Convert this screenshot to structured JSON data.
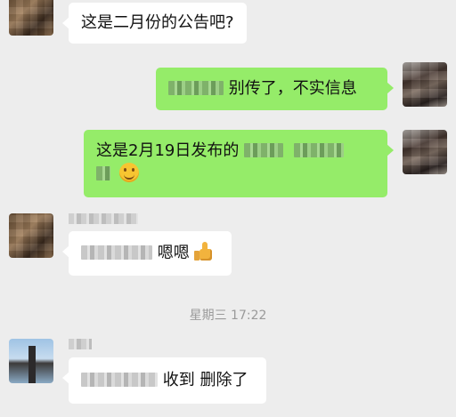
{
  "messages": [
    {
      "id": "m1",
      "side": "left",
      "avatar_icon": "brown-portrait-avatar",
      "text": "这是二月份的公告吧?"
    },
    {
      "id": "m2",
      "side": "right",
      "avatar_icon": "dark-portrait-avatar",
      "text_after_redaction": "别传了，不实信息"
    },
    {
      "id": "m3",
      "side": "right",
      "avatar_icon": "dark-portrait-avatar",
      "text_before_redaction": "这是2月19日发布的",
      "emoji": "smile-emoji"
    },
    {
      "id": "m4",
      "side": "left",
      "avatar_icon": "brown-portrait-avatar",
      "text_after_redaction": "嗯嗯",
      "emoji": "thumbs-up-emoji"
    },
    {
      "id": "m5",
      "side": "left",
      "avatar_icon": "blue-sky-avatar",
      "text_after_redaction": "收到 删除了"
    }
  ],
  "timestamp": "星期三 17:22",
  "colors": {
    "background": "#ededed",
    "bubble_self": "#95ec69",
    "bubble_other": "#ffffff",
    "timestamp_text": "#9a9a9a"
  }
}
